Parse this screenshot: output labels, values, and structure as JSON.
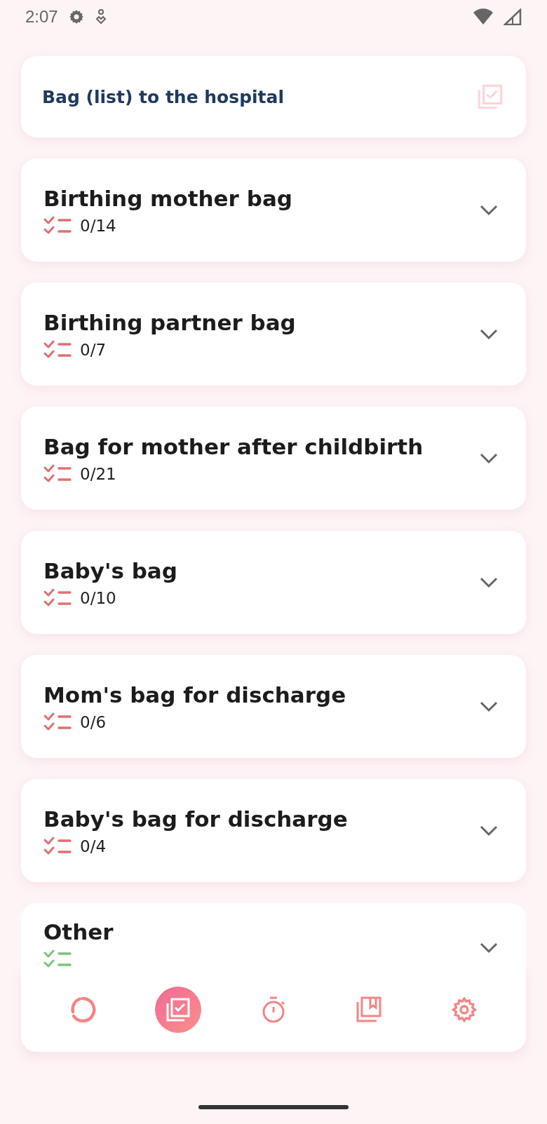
{
  "status_bar": {
    "time": "2:07"
  },
  "header": {
    "title": "Bag (list) to the hospital"
  },
  "bags": [
    {
      "title": "Birthing mother bag",
      "count": "0/14",
      "color": "#e07070",
      "expanded": false
    },
    {
      "title": "Birthing partner bag",
      "count": "0/7",
      "color": "#e07070",
      "expanded": false
    },
    {
      "title": "Bag for mother after childbirth",
      "count": "0/21",
      "color": "#e07070",
      "expanded": false
    },
    {
      "title": "Baby's bag",
      "count": "0/10",
      "color": "#e07070",
      "expanded": false
    },
    {
      "title": "Mom's bag for discharge",
      "count": "0/6",
      "color": "#e07070",
      "expanded": false
    },
    {
      "title": "Baby's bag for discharge",
      "count": "0/4",
      "color": "#e07070",
      "expanded": false
    },
    {
      "title": "Other",
      "color": "#7cc47f",
      "expanded": false
    }
  ],
  "nav": [
    {
      "kind": "progress",
      "selected": false
    },
    {
      "kind": "checklist",
      "selected": true
    },
    {
      "kind": "timer",
      "selected": false
    },
    {
      "kind": "library",
      "selected": false
    },
    {
      "kind": "settings",
      "selected": false
    }
  ]
}
